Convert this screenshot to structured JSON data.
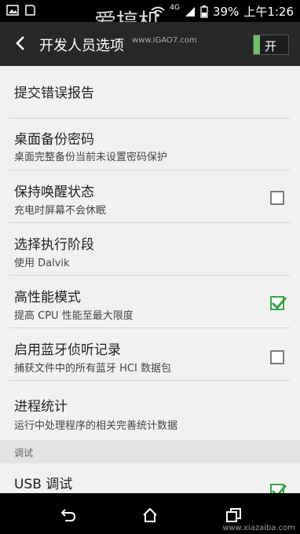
{
  "status_bar": {
    "network": "4G",
    "battery_percent": "39%",
    "time": "上午1:26"
  },
  "watermark": {
    "text": "爱搞机",
    "url": "www.iGAO7.com",
    "bottom_mark": "www.xiazaiba.com"
  },
  "appbar": {
    "title": "开发人员选项",
    "master_switch_label": "开"
  },
  "items": [
    {
      "title": "提交错误报告"
    },
    {
      "title": "桌面备份密码",
      "subtitle": "桌面完整备份当前未设置密码保护"
    },
    {
      "title": "保持唤醒状态",
      "subtitle": "充电时屏幕不会休眠",
      "checked": false
    },
    {
      "title": "选择执行阶段",
      "subtitle": "使用 Dalvik"
    },
    {
      "title": "高性能模式",
      "subtitle": "提高 CPU 性能至最大限度",
      "checked": true
    },
    {
      "title": "启用蓝牙侦听记录",
      "subtitle": "捕获文件中的所有蓝牙 HCI 数据包",
      "checked": false
    },
    {
      "title": "进程统计",
      "subtitle": "运行中处理程序的相关完善统计数据"
    }
  ],
  "section_header": "调试",
  "debug_items": [
    {
      "title": "USB 调试",
      "checked": true
    }
  ],
  "colors": {
    "accent": "#3aa24a",
    "appbar": "#282828",
    "background": "#f1f1f1"
  }
}
